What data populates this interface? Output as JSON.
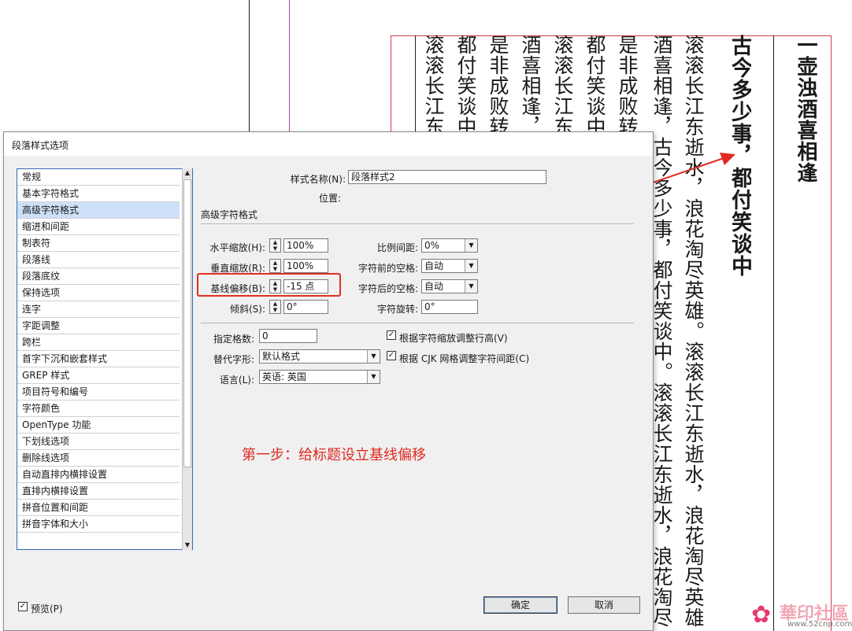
{
  "document": {
    "columns": [
      "滚滚长江东",
      "都付笑谈中",
      "是非成败转",
      "酒喜相逢，",
      "滚滚长江东",
      "都付笑谈中",
      "是非成败转",
      "酒喜相逢，古今多少事，都付笑谈中。滚滚长江东逝水，浪花淘尽",
      "滚滚长江东逝水，浪花淘尽英雄。滚滚长江东逝水，浪花淘尽英雄"
    ],
    "title_column": "古今多少事，都付笑谈中",
    "head_column": "一壶浊酒喜相逢"
  },
  "dialog": {
    "title": "段落样式选项",
    "categories": [
      "常规",
      "基本字符格式",
      "高级字符格式",
      "缩进和间距",
      "制表符",
      "段落线",
      "段落底纹",
      "保持选项",
      "连字",
      "字距调整",
      "跨栏",
      "首字下沉和嵌套样式",
      "GREP 样式",
      "项目符号和编号",
      "字符颜色",
      "OpenType 功能",
      "下划线选项",
      "删除线选项",
      "自动直排内横排设置",
      "直排内横排设置",
      "拼音位置和间距",
      "拼音字体和大小"
    ],
    "selected_category": "高级字符格式",
    "style_name_label": "样式名称(N):",
    "style_name_value": "段落样式2",
    "location_label": "位置:",
    "section_title": "高级字符格式",
    "horizontal_scale_label": "水平缩放(H):",
    "horizontal_scale_value": "100%",
    "vertical_scale_label": "垂直缩放(R):",
    "vertical_scale_value": "100%",
    "baseline_shift_label": "基线偏移(B):",
    "baseline_shift_value": "-15 点",
    "skew_label": "倾斜(S):",
    "skew_value": "0°",
    "proportional_spacing_label": "比例间距:",
    "proportional_spacing_value": "0%",
    "space_before_char_label": "字符前的空格:",
    "space_before_char_value": "自动",
    "space_after_char_label": "字符后的空格:",
    "space_after_char_value": "自动",
    "char_rotation_label": "字符旋转:",
    "char_rotation_value": "0°",
    "grid_count_label": "指定格数:",
    "grid_count_value": "0",
    "alternate_glyph_label": "替代字形:",
    "alternate_glyph_value": "默认格式",
    "language_label": "语言(L):",
    "language_value": "英语: 英国",
    "adjust_leading_label": "根据字符缩放调整行高(V)",
    "adjust_leading_checked": true,
    "cjk_grid_label": "根据 CJK 网格调整字符间距(C)",
    "cjk_grid_checked": true,
    "preview_label": "预览(P)",
    "preview_checked": true,
    "ok_label": "确定",
    "cancel_label": "取消"
  },
  "annotation": {
    "text": "第一步：给标题设立基线偏移",
    "color": "#e02a20"
  },
  "watermark": {
    "brand": "華印社區",
    "url": "www.52cnp.com"
  },
  "icons": {
    "spin": "spin-up-down-icon",
    "dropdown": "chevron-down-icon",
    "check": "checkmark-icon"
  }
}
